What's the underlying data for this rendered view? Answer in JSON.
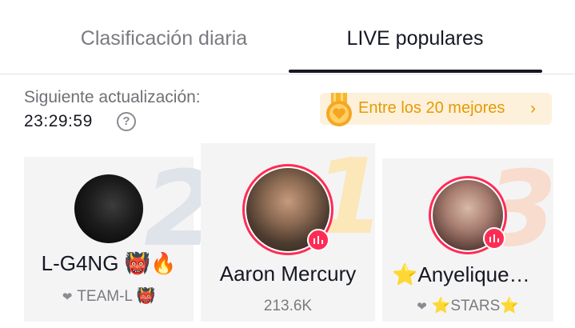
{
  "tabs": [
    {
      "label": "Clasificación diaria",
      "active": false
    },
    {
      "label": "LIVE populares",
      "active": true
    }
  ],
  "update": {
    "label": "Siguiente actualización:",
    "time": "23:29:59",
    "help_icon": "question-circle-icon"
  },
  "top20": {
    "label": "Entre los 20 mejores",
    "chevron": "›",
    "icon": "gold-medal-heart-icon"
  },
  "ranking": [
    {
      "rank": "2",
      "name": "L-G4NG 👹🔥",
      "subtitle_icon": "heart-icon",
      "subtitle": "TEAM-L 👹",
      "live": false
    },
    {
      "rank": "1",
      "name": "Aaron Mercury",
      "subtitle": "213.6K",
      "live": true
    },
    {
      "rank": "3",
      "name": "⭐Anyelique…",
      "subtitle_icon": "heart-icon",
      "subtitle": "⭐STARS⭐",
      "live": true
    }
  ],
  "colors": {
    "accent": "#fe2c55",
    "gold": "#e79a00",
    "pill_bg": "#fdf1dc",
    "card_bg": "#f4f4f5"
  }
}
